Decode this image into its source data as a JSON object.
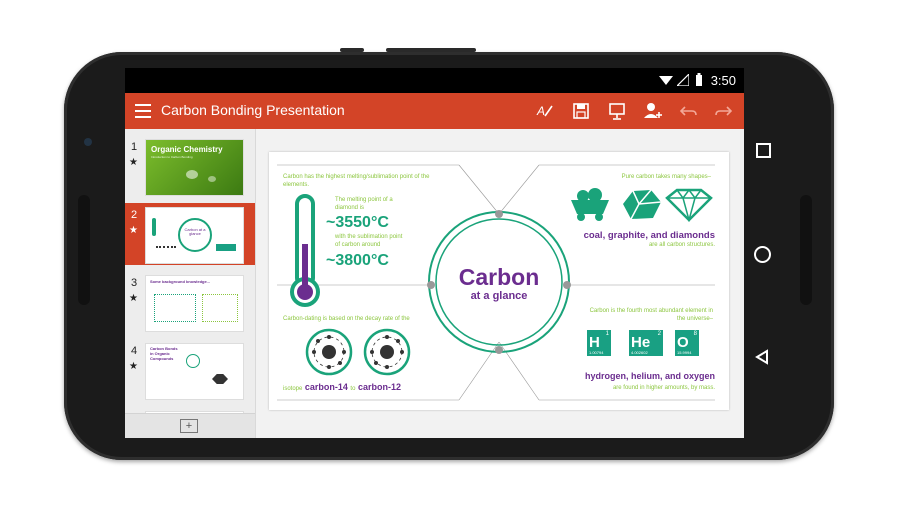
{
  "status": {
    "time": "3:50"
  },
  "app": {
    "title": "Carbon Bonding Presentation"
  },
  "toolbar": {
    "icons": [
      "format-text-icon",
      "save-icon",
      "present-icon",
      "share-person-icon",
      "undo-icon",
      "redo-icon"
    ]
  },
  "thumbnails": [
    {
      "number": "1",
      "title": "Organic Chemistry",
      "subtitle": "Introduction to Carbon Bonding",
      "selected": false
    },
    {
      "number": "2",
      "title": "Carbon at a glance",
      "selected": true
    },
    {
      "number": "3",
      "title": "Some background knowledge...",
      "selected": false
    },
    {
      "number": "4",
      "title": "Carbon Bonds in Organic Compounds",
      "selected": false
    }
  ],
  "slide": {
    "center_title": "Carbon",
    "center_subtitle": "at a glance",
    "melt_intro": "Carbon has the highest melting/sublimation point of the elements.",
    "melt_point_label": "The melting point of a diamond is",
    "melt_temp": "~3550°C",
    "sublimation_label": "with the sublimation point of carbon around",
    "sublimation_temp": "~3800°C",
    "shapes_intro": "Pure carbon takes many shapes–",
    "shapes_list": "coal, graphite, and diamonds",
    "shapes_outro": "are all carbon structures.",
    "dating_intro": "Carbon-dating is based on the decay rate of the",
    "isotope_prefix": "isotope",
    "isotope_a": "carbon-14",
    "isotope_join": "to",
    "isotope_b": "carbon-12",
    "abundance_intro": "Carbon is the fourth most abundant element in the universe–",
    "abundance_list": "hydrogen, helium, and oxygen",
    "abundance_outro": "are found in higher amounts, by mass.",
    "elements": [
      {
        "symbol": "H",
        "number": "1",
        "mass": "1.00794"
      },
      {
        "symbol": "He",
        "number": "2",
        "mass": "4.002602"
      },
      {
        "symbol": "O",
        "number": "8",
        "mass": "15.9994"
      }
    ]
  },
  "colors": {
    "accent": "#d34427",
    "teal": "#1aa37a",
    "purple": "#6b2d8f",
    "green": "#8cc63f"
  }
}
